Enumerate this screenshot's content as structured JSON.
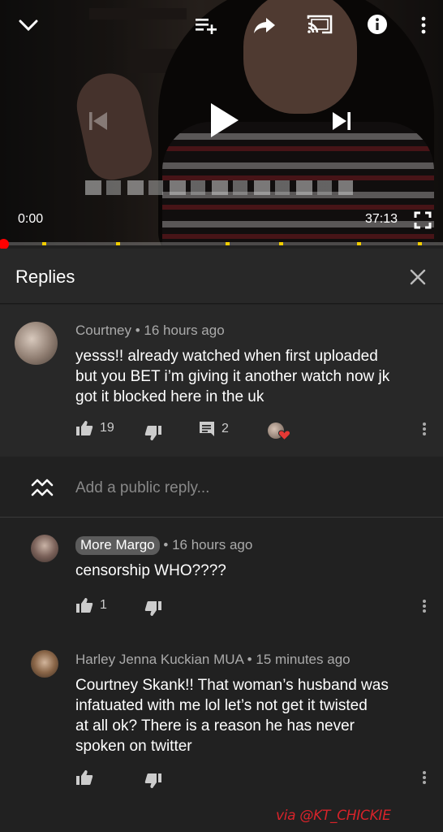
{
  "player": {
    "current_time": "0:00",
    "duration": "37:13",
    "progress_fraction": 0.0,
    "icons": [
      "collapse-chevron-icon",
      "add-to-queue-icon",
      "share-icon",
      "cast-icon",
      "info-icon",
      "more-vert-icon",
      "previous-icon",
      "play-icon",
      "next-icon",
      "fullscreen-icon"
    ]
  },
  "replies_panel": {
    "title": "Replies",
    "close_icon": "close-icon"
  },
  "parent_comment": {
    "author": "Courtney",
    "time": "16 hours ago",
    "text_lines": [
      "yesss!! already watched when first uploaded",
      "but you BET i’m giving it another watch now jk",
      "got it blocked here in the uk"
    ],
    "likes": "19",
    "reply_count": "2",
    "hearted": true
  },
  "reply_input": {
    "placeholder": "Add a public reply..."
  },
  "replies": [
    {
      "author": "More Margo",
      "is_creator": true,
      "time": "16 hours ago",
      "text_lines": [
        "censorship WHO????"
      ],
      "likes": "1"
    },
    {
      "author": "Harley Jenna Kuckian MUA",
      "is_creator": false,
      "time": "15 minutes ago",
      "text_lines": [
        "Courtney Skank!! That woman’s husband was",
        "infatuated with me lol let’s not get it twisted",
        "at all ok? There is a reason he has never",
        "spoken on twitter"
      ],
      "likes": ""
    }
  ],
  "separator": "•",
  "watermark": "via @KT_CHICKIE",
  "colors": {
    "background": "#212121",
    "header": "#282828",
    "progress": "#ff0000",
    "heart": "#e53935",
    "watermark": "#d8232a"
  }
}
